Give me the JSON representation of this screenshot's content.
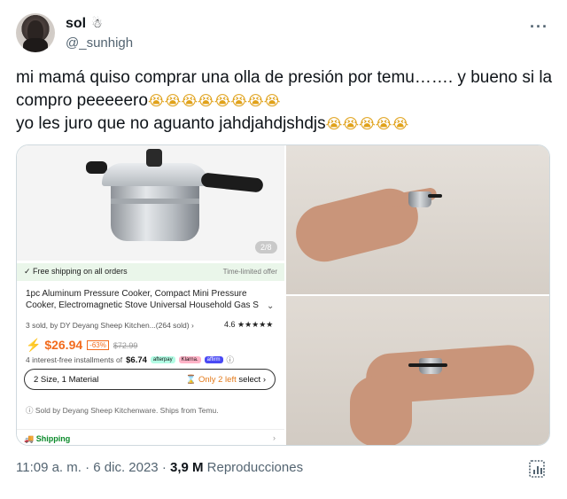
{
  "user": {
    "display_name": "sol",
    "name_emoji": "☃",
    "handle": "@_sunhigh",
    "more_icon": "more-dots-icon"
  },
  "tweet": {
    "line1": "mi mamá quiso comprar una olla de presión por temu……. y bueno si la",
    "line2_text": "compro peeeeero",
    "line2_emojis": "😭😭😭😭😭😭😭😭",
    "line3_text": "yo les juro que no aguanto  jahdjahdjshdjs",
    "line3_emojis": "😭😭😭😭😭"
  },
  "product": {
    "pager": "2/8",
    "free_shipping": "✓ Free shipping on all orders",
    "time_limited": "Time-limited offer",
    "title_line1": "1pc Aluminum Pressure Cooker, Compact Mini Pressure",
    "title_line2": "Cooker, Electromagnetic Stove Universal Household Gas S",
    "sold_info": "3 sold, by DY Deyang Sheep Kitchen...(264 sold) ›",
    "rating_value": "4.6",
    "rating_stars": "★★★★★",
    "price": "⚡ $26.94",
    "discount": "-63%",
    "old_price": "$72.99",
    "installments_prefix": "4 interest-free installments of",
    "installments_amount": "$6.74",
    "pay_afterpay": "afterpay",
    "pay_klarna": "Klarna.",
    "pay_affirm": "affirm",
    "variant_label": "2 Size, 1 Material",
    "variant_left": "⌛ Only 2 left",
    "variant_select": "select ›",
    "sold_by": "ⓘ Sold by Deyang Sheep Kitchenware. Ships from Temu.",
    "shipping_label": "🚚 Shipping",
    "shipping_arrow": "›"
  },
  "footer": {
    "time": "11:09 a. m. · 6 dic. 2023 · ",
    "views_count": "3,9 M",
    "views_label": " Reproducciones"
  }
}
